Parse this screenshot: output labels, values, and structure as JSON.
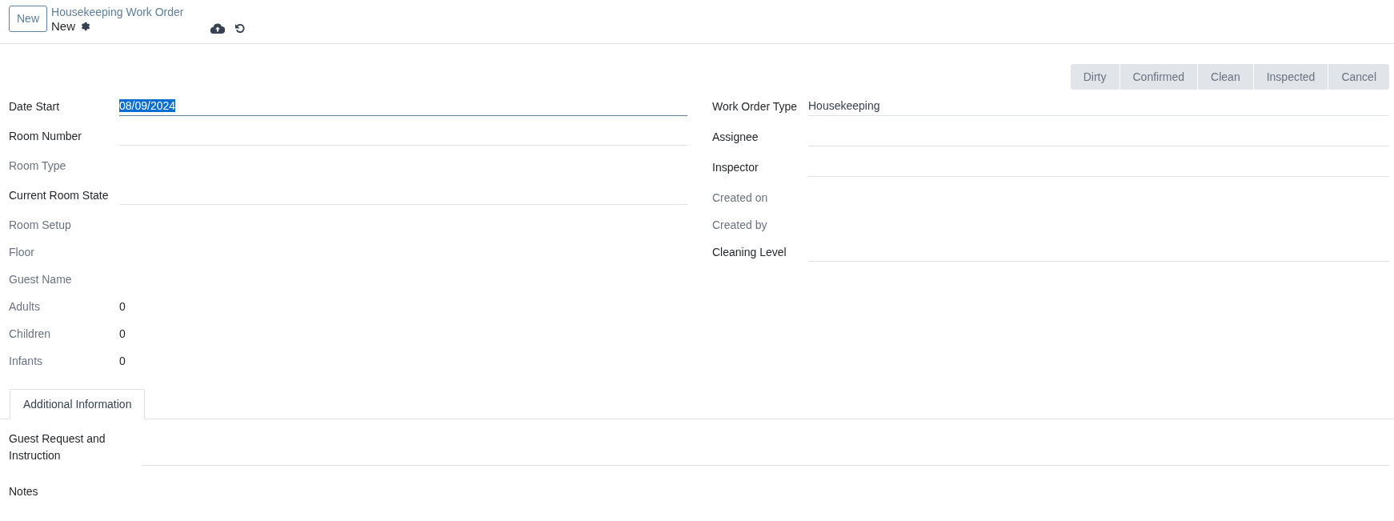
{
  "header": {
    "new_button": "New",
    "breadcrumb": "Housekeeping Work Order",
    "record": "New"
  },
  "status_bar": [
    {
      "label": "Dirty",
      "selected": false
    },
    {
      "label": "Confirmed",
      "selected": false
    },
    {
      "label": "Clean",
      "selected": false
    },
    {
      "label": "Inspected",
      "selected": false
    },
    {
      "label": "Cancel",
      "selected": false
    }
  ],
  "left_fields": [
    {
      "label": "Date Start",
      "muted": false,
      "kind": "input",
      "value": "08/09/2024",
      "focused": true
    },
    {
      "label": "Room Number",
      "muted": false,
      "kind": "input",
      "focused": false
    },
    {
      "label": "Room Type",
      "muted": true,
      "kind": "readonly"
    },
    {
      "label": "Current Room State",
      "muted": false,
      "kind": "input",
      "focused": false
    },
    {
      "label": "Room Setup",
      "muted": true,
      "kind": "readonly"
    },
    {
      "label": "Floor",
      "muted": true,
      "kind": "readonly"
    },
    {
      "label": "Guest Name",
      "muted": true,
      "kind": "readonly"
    },
    {
      "label": "Adults",
      "muted": true,
      "kind": "readonly",
      "value": "0"
    },
    {
      "label": "Children",
      "muted": true,
      "kind": "readonly",
      "value": "0"
    },
    {
      "label": "Infants",
      "muted": true,
      "kind": "readonly",
      "value": "0"
    }
  ],
  "right_fields": [
    {
      "label": "Work Order Type",
      "muted": false,
      "kind": "input",
      "value": "Housekeeping",
      "focused": false
    },
    {
      "label": "Assignee",
      "muted": false,
      "kind": "input",
      "focused": false
    },
    {
      "label": "Inspector",
      "muted": false,
      "kind": "input",
      "focused": false
    },
    {
      "label": "Created on",
      "muted": true,
      "kind": "readonly"
    },
    {
      "label": "Created by",
      "muted": true,
      "kind": "readonly"
    },
    {
      "label": "Cleaning Level",
      "muted": false,
      "kind": "input",
      "focused": false
    }
  ],
  "tabs": [
    {
      "label": "Additional Information",
      "selected": true
    }
  ],
  "tab_fields": [
    {
      "label": "Guest Request and Instruction",
      "kind": "input"
    },
    {
      "label": "Notes",
      "kind": "readonly"
    }
  ]
}
